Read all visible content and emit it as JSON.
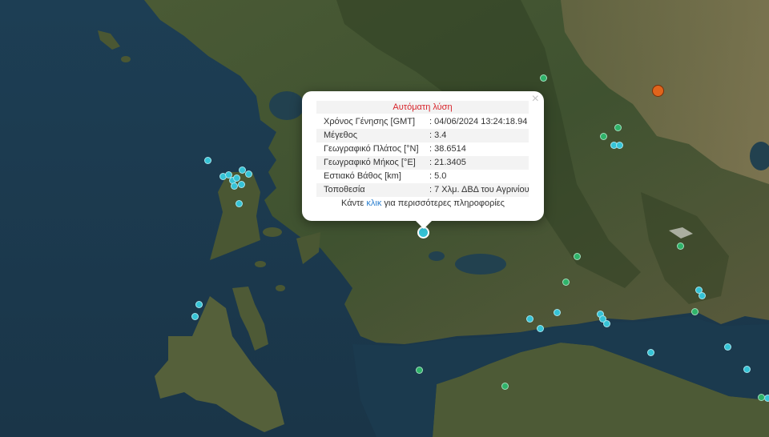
{
  "popup": {
    "title": "Αυτόματη λύση",
    "rows": [
      {
        "label": "Χρόνος Γένησης [GMT]",
        "value": ": 04/06/2024 13:24:18.94"
      },
      {
        "label": "Μέγεθος",
        "value": ": 3.4"
      },
      {
        "label": "Γεωγραφικό Πλάτος [°N]",
        "value": ": 38.6514"
      },
      {
        "label": "Γεωγραφικό Μήκος [°E]",
        "value": ": 21.3405"
      },
      {
        "label": "Εστιακό Βάθος [km]",
        "value": ": 5.0"
      },
      {
        "label": "Τοποθεσία",
        "value": ": 7 Χλμ. ΔΒΔ του Αγρινίου"
      }
    ],
    "more_prefix": "Κάντε ",
    "more_link": "κλικ",
    "more_suffix": " για περισσότερες πληροφορίες",
    "close_symbol": "×"
  },
  "colors": {
    "recent_marker": "#35c3d6",
    "older_marker": "#2fb36a",
    "strong_marker": "#e0641c",
    "popup_title": "#d8232a",
    "link": "#2a7fd0"
  },
  "marker_types": [
    "cyan",
    "green",
    "orange",
    "selected"
  ]
}
